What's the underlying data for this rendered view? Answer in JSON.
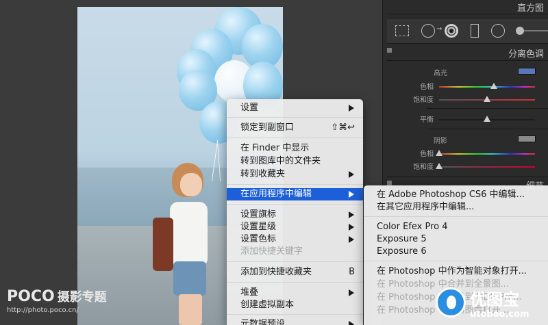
{
  "panel": {
    "histogram_title": "直方图",
    "split_toning_title": "分离色调",
    "detail_title": "细节",
    "highlights": {
      "title": "高光",
      "hue_label": "色相",
      "saturation_label": "饱和度",
      "swatch_color": "#5a78b8",
      "hue_value_fraction": 0.58,
      "saturation_value_fraction": 0.5
    },
    "balance": {
      "label": "平衡",
      "value_fraction": 0.5
    },
    "shadows": {
      "title": "阴影",
      "hue_label": "色相",
      "saturation_label": "饱和度",
      "swatch_color": "#8a8a8a",
      "hue_value_fraction": 0.0,
      "saturation_value_fraction": 0.0
    },
    "tools": [
      "crop-overlay-icon",
      "spot-removal-icon",
      "red-eye-icon",
      "graduated-filter-icon",
      "radial-filter-icon",
      "adjustment-brush-icon"
    ]
  },
  "context_menu": {
    "items": [
      {
        "label": "设置",
        "has_submenu": true
      },
      {
        "label": "锁定到副窗口",
        "shortcut": "⇧⌘↩"
      },
      {
        "label": "在 Finder 中显示"
      },
      {
        "label": "转到图库中的文件夹"
      },
      {
        "label": "转到收藏夹",
        "has_submenu": true
      },
      {
        "label": "在应用程序中编辑",
        "has_submenu": true,
        "selected": true
      },
      {
        "label": "设置旗标",
        "has_submenu": true
      },
      {
        "label": "设置星级",
        "has_submenu": true
      },
      {
        "label": "设置色标",
        "has_submenu": true
      },
      {
        "label": "添加快捷关键字",
        "disabled": true
      },
      {
        "label": "添加到快捷收藏夹",
        "shortcut": "B"
      },
      {
        "label": "堆叠",
        "has_submenu": true
      },
      {
        "label": "创建虚拟副本"
      },
      {
        "label": "元数据预设",
        "has_submenu": true
      }
    ]
  },
  "submenu": {
    "items": [
      {
        "label": "在 Adobe Photoshop CS6 中编辑..."
      },
      {
        "label": "在其它应用程序中编辑..."
      },
      {
        "label": "Color Efex Pro 4"
      },
      {
        "label": "Exposure 5"
      },
      {
        "label": "Exposure 6"
      },
      {
        "label": "在 Photoshop 中作为智能对象打开..."
      },
      {
        "label": "在 Photoshop 中合并到全景图...",
        "disabled": true
      },
      {
        "label": "在 Photoshop 中合并到 HDR Pro...",
        "disabled": true
      },
      {
        "label": "在 Photoshop 中作为图层打开...",
        "disabled": true
      },
      {
        "label": "在 Photoshop 中作为图层打开...",
        "disabled": true
      }
    ]
  },
  "watermarks": {
    "poco_logo": "POCO",
    "poco_tag": "摄影专题",
    "poco_url": "http://photo.poco.cn/",
    "utobao_brand": "优图宝",
    "utobao_domain": "utobao.com"
  },
  "colors": {
    "menu_highlight": "#1d5fd8",
    "panel_bg": "#2b2b2b",
    "app_bg": "#3b3b3b"
  }
}
